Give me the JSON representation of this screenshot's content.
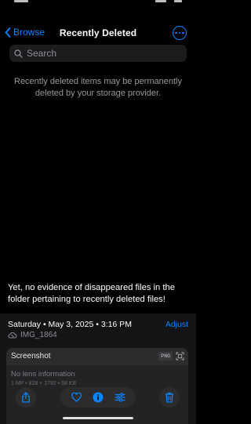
{
  "nav": {
    "back_label": "Browse",
    "title": "Recently Deleted"
  },
  "search": {
    "placeholder": "Search"
  },
  "notice": "Recently deleted items may be permanently deleted by your storage provider.",
  "caption": "Yet, no evidence of disappeared files in the folder pertaining to recently deleted files!",
  "info": {
    "date": "Saturday • May 3, 2025 • 3:16 PM",
    "adjust_label": "Adjust",
    "filename": "IMG_1864",
    "card_title": "Screenshot",
    "format_badge": "PNG",
    "lens_text": "No lens information",
    "meta": "1 MP • 828 × 1792 • 58 KB"
  },
  "colors": {
    "accent": "#0a84ff",
    "background": "#000000"
  },
  "icons": [
    "chevron-left-icon",
    "more-icon",
    "search-icon",
    "cloud-icon",
    "live-text-icon",
    "share-icon",
    "heart-icon",
    "info-icon",
    "adjust-icon",
    "trash-icon"
  ]
}
